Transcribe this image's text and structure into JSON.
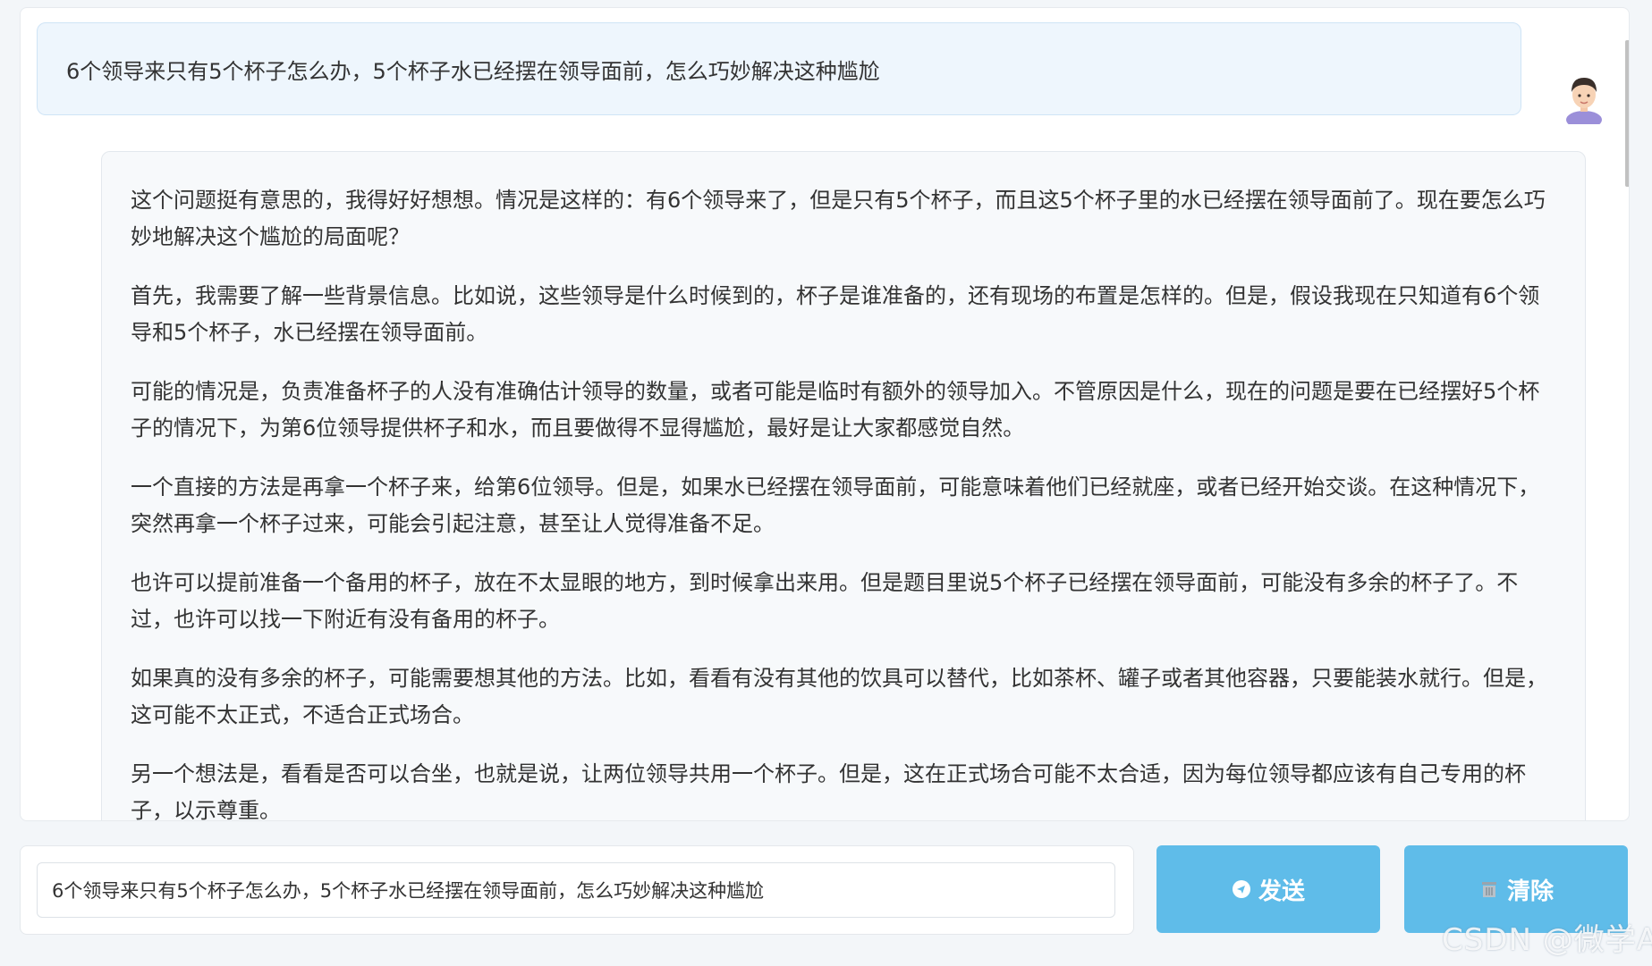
{
  "user_message": {
    "text": "6个领导来只有5个杯子怎么办，5个杯子水已经摆在领导面前，怎么巧妙解决这种尴尬",
    "avatar_icon": "user-avatar-icon"
  },
  "assistant_message": {
    "paragraphs": [
      "这个问题挺有意思的，我得好好想想。情况是这样的：有6个领导来了，但是只有5个杯子，而且这5个杯子里的水已经摆在领导面前了。现在要怎么巧妙地解决这个尴尬的局面呢？",
      "首先，我需要了解一些背景信息。比如说，这些领导是什么时候到的，杯子是谁准备的，还有现场的布置是怎样的。但是，假设我现在只知道有6个领导和5个杯子，水已经摆在领导面前。",
      "可能的情况是，负责准备杯子的人没有准确估计领导的数量，或者可能是临时有额外的领导加入。不管原因是什么，现在的问题是要在已经摆好5个杯子的情况下，为第6位领导提供杯子和水，而且要做得不显得尴尬，最好是让大家都感觉自然。",
      "一个直接的方法是再拿一个杯子来，给第6位领导。但是，如果水已经摆在领导面前，可能意味着他们已经就座，或者已经开始交谈。在这种情况下，突然再拿一个杯子过来，可能会引起注意，甚至让人觉得准备不足。",
      "也许可以提前准备一个备用的杯子，放在不太显眼的地方，到时候拿出来用。但是题目里说5个杯子已经摆在领导面前，可能没有多余的杯子了。不过，也许可以找一下附近有没有备用的杯子。",
      "如果真的没有多余的杯子，可能需要想其他的方法。比如，看看有没有其他的饮具可以替代，比如茶杯、罐子或者其他容器，只要能装水就行。但是，这可能不太正式，不适合正式场合。",
      "另一个想法是，看看是否可以合坐，也就是说，让两位领导共用一个杯子。但是，这在正式场合可能不太合适，因为每位领导都应该有自己专用的杯子，以示尊重。"
    ]
  },
  "input": {
    "value": "6个领导来只有5个杯子怎么办，5个杯子水已经摆在领导面前，怎么巧妙解决这种尴尬"
  },
  "buttons": {
    "send_label": "发送",
    "send_icon": "send-icon",
    "clear_label": "清除",
    "clear_icon": "trash-icon"
  },
  "watermark": {
    "text": "CSDN @微学AI"
  },
  "colors": {
    "button_bg": "#5fbce9",
    "user_bubble_bg": "#eef6fd",
    "assistant_bubble_bg": "#f7f9fb"
  }
}
